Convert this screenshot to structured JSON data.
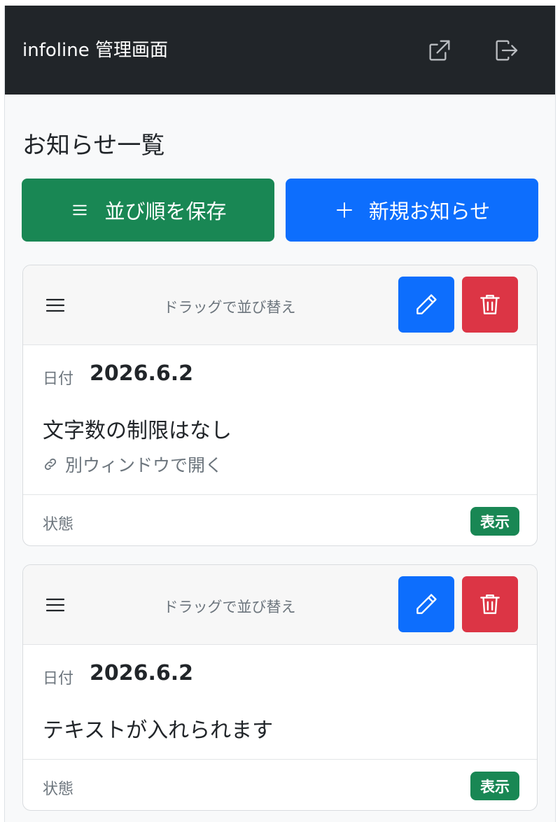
{
  "navbar": {
    "brand": "infoline 管理画面",
    "icons": [
      "external-link-icon",
      "logout-icon"
    ]
  },
  "page": {
    "title": "お知らせ一覧"
  },
  "actions": {
    "save_order_label": "並び順を保存",
    "new_notice_label": "新規お知らせ"
  },
  "notices": [
    {
      "drag_label": "ドラッグで並び替え",
      "date_label": "日付",
      "date": "2026.6.2",
      "text": "文字数の制限はなし",
      "link_label": "別ウィンドウで開く",
      "state_label": "状態",
      "state": "表示"
    },
    {
      "drag_label": "ドラッグで並び替え",
      "date_label": "日付",
      "date": "2026.6.2",
      "text": "テキストが入れられます",
      "state_label": "状態",
      "state": "表示"
    }
  ],
  "colors": {
    "navbar": "#212529",
    "success": "#198754",
    "primary": "#0d6efd",
    "danger": "#dc3545"
  }
}
